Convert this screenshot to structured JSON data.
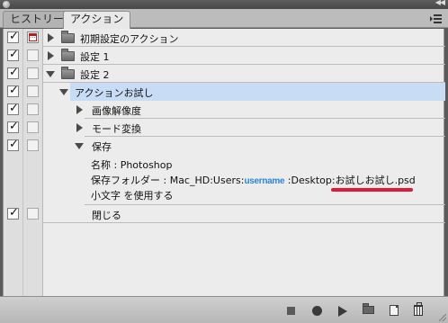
{
  "tabs": [
    {
      "label": "ヒストリー",
      "active": false
    },
    {
      "label": "アクション",
      "active": true
    }
  ],
  "actions": [
    {
      "kind": "set",
      "label": "初期設定のアクション",
      "expanded": false,
      "checked": true,
      "dialog": true
    },
    {
      "kind": "set",
      "label": "設定 1",
      "expanded": false,
      "checked": true,
      "dialog": false
    },
    {
      "kind": "set",
      "label": "設定 2",
      "expanded": true,
      "checked": true,
      "dialog": false
    },
    {
      "kind": "action",
      "label": "アクションお試し",
      "expanded": true,
      "selected": true,
      "checked": true
    },
    {
      "kind": "step",
      "label": "画像解像度",
      "expanded": false,
      "checked": true
    },
    {
      "kind": "step",
      "label": "モード変換",
      "expanded": false,
      "checked": true
    },
    {
      "kind": "step",
      "label": "保存",
      "expanded": true,
      "checked": true
    },
    {
      "kind": "step",
      "label": "閉じる",
      "expanded": false,
      "checked": true
    }
  ],
  "save_details": {
    "name_line": "名称 : Photoshop",
    "folder_prefix": "保存フォルダー : Mac_HD:Users:",
    "folder_user": "username",
    "folder_mid": " :Desktop:",
    "folder_file": "お試しお試し.psd",
    "lowercase_line": "小文字 を使用する"
  },
  "toolbar": {
    "buttons": [
      "stop-icon",
      "record-icon",
      "play-icon",
      "new-set-icon",
      "new-action-icon",
      "trash-icon"
    ]
  },
  "colors": {
    "selection": "#c9dcf6",
    "username_text": "#2a86d6",
    "highlight_underline": "#e0193b"
  }
}
